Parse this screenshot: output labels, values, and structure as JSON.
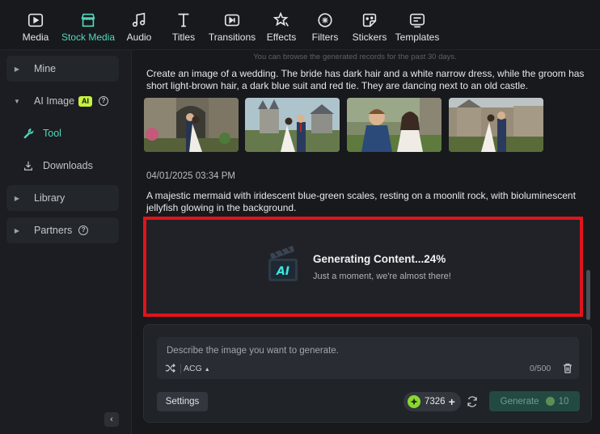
{
  "toolbar": {
    "items": [
      {
        "label": "Media",
        "icon": "media-icon"
      },
      {
        "label": "Stock Media",
        "icon": "stock-media-icon",
        "active": true
      },
      {
        "label": "Audio",
        "icon": "audio-icon"
      },
      {
        "label": "Titles",
        "icon": "titles-icon"
      },
      {
        "label": "Transitions",
        "icon": "transitions-icon"
      },
      {
        "label": "Effects",
        "icon": "effects-icon"
      },
      {
        "label": "Filters",
        "icon": "filters-icon"
      },
      {
        "label": "Stickers",
        "icon": "stickers-icon"
      },
      {
        "label": "Templates",
        "icon": "templates-icon"
      }
    ]
  },
  "sidebar": {
    "mine": "Mine",
    "ai_image": "AI Image",
    "ai_badge": "AI",
    "tool": "Tool",
    "downloads": "Downloads",
    "library": "Library",
    "partners": "Partners"
  },
  "main": {
    "notice": "You can browse the generated records for the past 30 days.",
    "record1": {
      "prompt": "Create an image of a wedding. The bride has dark hair and a white narrow dress, while the groom has short light-brown hair, a dark blue suit and red tie. They are dancing next to an old castle."
    },
    "record2": {
      "timestamp": "04/01/2025 03:34 PM",
      "prompt": "A majestic mermaid with iridescent blue-green scales, resting on a moonlit rock, with bioluminescent jellyfish glowing in the background."
    },
    "generating": {
      "title": "Generating Content...24%",
      "subtitle": "Just a moment, we're almost there!",
      "progress": 0.24
    }
  },
  "composer": {
    "placeholder": "Describe the image you want to generate.",
    "style": "ACG",
    "char_count": "0/500",
    "settings": "Settings",
    "credits": "7326",
    "generate": "Generate",
    "cost": "10"
  },
  "colors": {
    "accent": "#54d7bb",
    "highlight_border": "#e0141b",
    "ai_badge": "#c6f13e",
    "credit_coin": "#8ad82e"
  }
}
